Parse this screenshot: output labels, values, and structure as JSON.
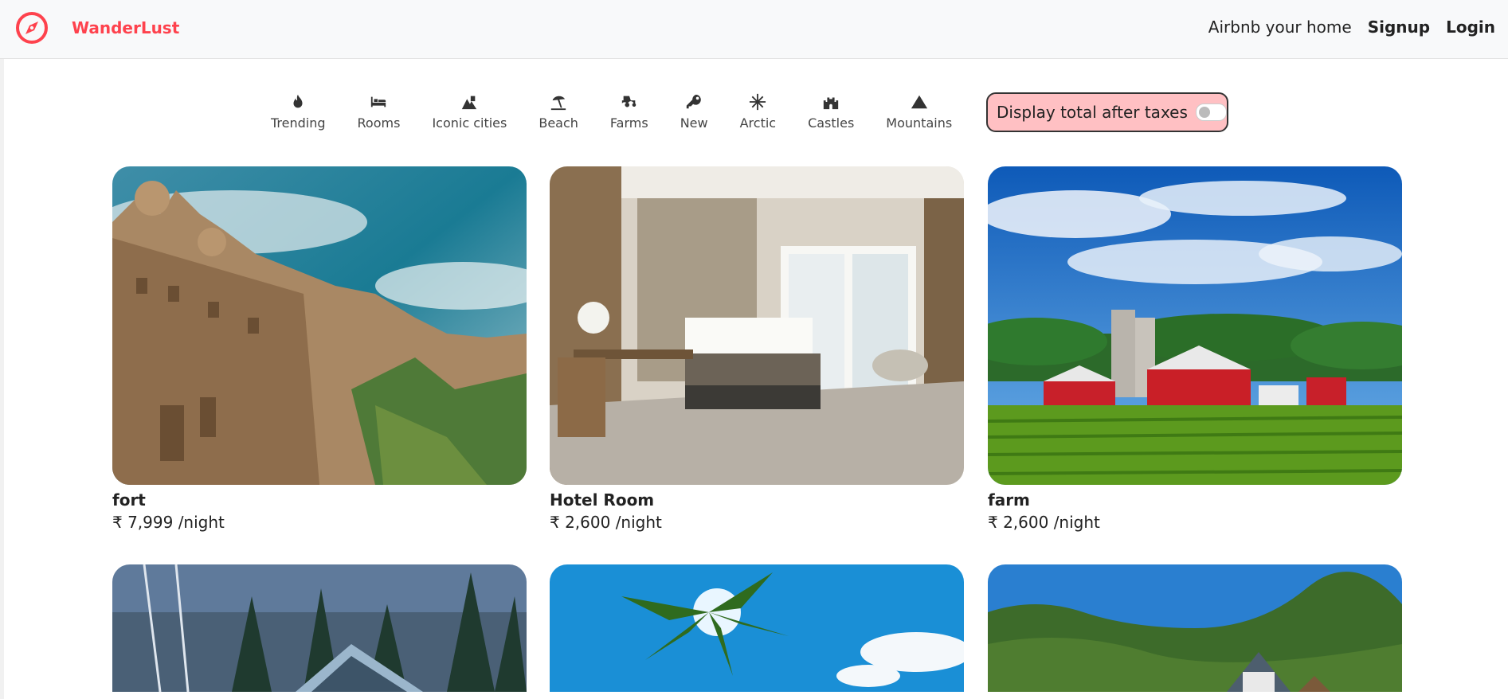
{
  "navbar": {
    "brand": "WanderLust",
    "brand_icon": "compass-icon",
    "brand_color": "#fe424d",
    "links": [
      {
        "label": "Airbnb your home"
      },
      {
        "label": "Signup"
      },
      {
        "label": "Login"
      }
    ]
  },
  "filters": [
    {
      "label": "Trending",
      "icon": "fire-icon"
    },
    {
      "label": "Rooms",
      "icon": "bed-icon"
    },
    {
      "label": "Iconic cities",
      "icon": "city-icon"
    },
    {
      "label": "Beach",
      "icon": "umbrella-beach-icon"
    },
    {
      "label": "Farms",
      "icon": "tractor-icon"
    },
    {
      "label": "New",
      "icon": "key-icon"
    },
    {
      "label": "Arctic",
      "icon": "snowflake-icon"
    },
    {
      "label": "Castles",
      "icon": "castle-icon"
    },
    {
      "label": "Mountains",
      "icon": "mountain-icon"
    }
  ],
  "tax_toggle": {
    "label": "Display total after taxes",
    "enabled": false,
    "background": "#ffc0c3"
  },
  "listings": [
    {
      "title": "fort",
      "price": "₹ 7,999 /night"
    },
    {
      "title": "Hotel Room",
      "price": "₹ 2,600 /night"
    },
    {
      "title": "farm",
      "price": "₹ 2,600 /night"
    },
    {
      "title": "",
      "price": ""
    },
    {
      "title": "",
      "price": ""
    },
    {
      "title": "",
      "price": ""
    }
  ]
}
